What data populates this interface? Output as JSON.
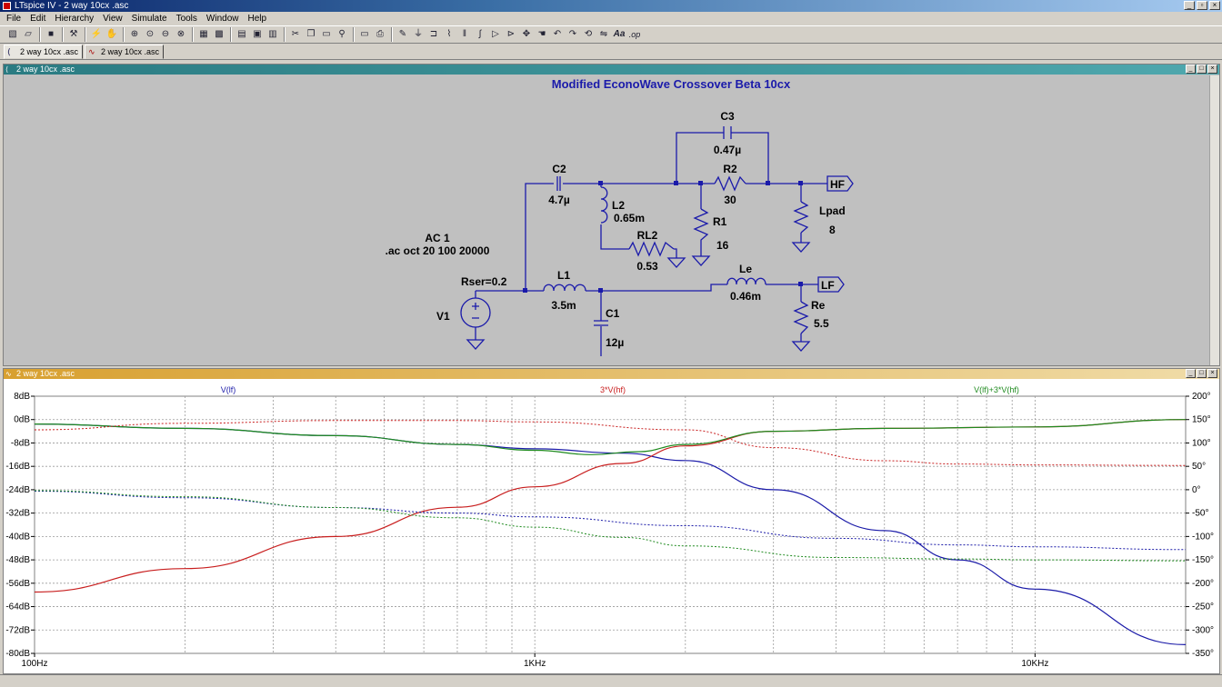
{
  "app": {
    "title": "LTspice IV - 2 way 10cx .asc"
  },
  "menu": [
    "File",
    "Edit",
    "Hierarchy",
    "View",
    "Simulate",
    "Tools",
    "Window",
    "Help"
  ],
  "toolbar_icons": [
    "new-schematic-icon",
    "open-icon",
    "save-icon",
    "control-panel-icon",
    "run-icon",
    "halt-icon",
    "zoom-in-icon",
    "pan-icon",
    "zoom-out-icon",
    "zoom-fit-icon",
    "autoscale-icon",
    "grid-icon",
    "tile-horizontal-icon",
    "cascade-icon",
    "tile-vertical-icon",
    "cut-icon",
    "copy-icon",
    "paste-icon",
    "find-icon",
    "print-setup-icon",
    "print-icon",
    "wire-icon",
    "ground-icon",
    "label-icon",
    "resistor-icon",
    "capacitor-icon",
    "inductor-icon",
    "diode-icon",
    "component-icon",
    "move-icon",
    "drag-icon",
    "undo-icon",
    "redo-icon",
    "rotate-icon",
    "mirror-icon",
    "text-icon",
    "spice-directive-icon"
  ],
  "tabs": [
    {
      "label": "2 way 10cx .asc",
      "icon": "schematic-icon"
    },
    {
      "label": "2 way 10cx .asc",
      "icon": "waveform-icon"
    }
  ],
  "schematic": {
    "window_title": "2 way 10cx .asc",
    "title": "Modified EconoWave Crossover Beta 10cx",
    "source": {
      "name": "V1",
      "value": "AC 1",
      "directive": ".ac oct 20 100 20000",
      "rser": "Rser=0.2"
    },
    "components": [
      {
        "ref": "C3",
        "value": "0.47µ"
      },
      {
        "ref": "R2",
        "value": "30"
      },
      {
        "ref": "C2",
        "value": "4.7µ"
      },
      {
        "ref": "L2",
        "value": "0.65m"
      },
      {
        "ref": "RL2",
        "value": "0.53"
      },
      {
        "ref": "R1",
        "value": "16"
      },
      {
        "ref": "Lpad",
        "value": "8"
      },
      {
        "ref": "L1",
        "value": "3.5m"
      },
      {
        "ref": "C1",
        "value": "12µ"
      },
      {
        "ref": "Le",
        "value": "0.46m"
      },
      {
        "ref": "Re",
        "value": "5.5"
      }
    ],
    "net_labels": [
      "HF",
      "LF"
    ]
  },
  "plot": {
    "window_title": "2 way 10cx .asc",
    "colors": {
      "v_lf": "#1a1aa8",
      "v_hf3": "#c81e1e",
      "v_sum": "#1e8a1e"
    }
  },
  "chart_data": {
    "type": "line",
    "x_scale": "log",
    "xlim": [
      100,
      20000
    ],
    "x_ticks": [
      "100Hz",
      "1KHz",
      "10KHz"
    ],
    "y_left": {
      "label": "",
      "ylim": [
        -80,
        8
      ],
      "ticks": [
        "8dB",
        "0dB",
        "-8dB",
        "-16dB",
        "-24dB",
        "-32dB",
        "-40dB",
        "-48dB",
        "-56dB",
        "-64dB",
        "-72dB",
        "-80dB"
      ]
    },
    "y_right": {
      "label": "",
      "ylim": [
        -350,
        200
      ],
      "ticks": [
        "200°",
        "150°",
        "100°",
        "50°",
        "0°",
        "-50°",
        "-100°",
        "-150°",
        "-200°",
        "-250°",
        "-300°",
        "-350°"
      ]
    },
    "grid": true,
    "legend": [
      {
        "name": "V(lf)",
        "color": "#1a1aa8"
      },
      {
        "name": "3*V(hf)",
        "color": "#c81e1e"
      },
      {
        "name": "V(lf)+3*V(hf)",
        "color": "#1e8a1e"
      }
    ],
    "series": [
      {
        "name": "V(lf)",
        "axis": "magnitude",
        "x": [
          100,
          200,
          400,
          700,
          1000,
          1500,
          2000,
          3000,
          5000,
          7000,
          10000,
          20000
        ],
        "y": [
          -1.5,
          -3,
          -5.5,
          -8.5,
          -10,
          -11.5,
          -14,
          -24,
          -38,
          -48,
          -58,
          -77
        ]
      },
      {
        "name": "3*V(hf)",
        "axis": "magnitude",
        "x": [
          100,
          200,
          400,
          700,
          1000,
          1500,
          2000,
          3000,
          5000,
          10000,
          20000
        ],
        "y": [
          -59,
          -51,
          -40,
          -30,
          -23,
          -15,
          -9,
          -4,
          -3,
          -2.5,
          0
        ]
      },
      {
        "name": "V(lf)+3*V(hf)",
        "axis": "magnitude",
        "x": [
          100,
          200,
          400,
          700,
          1000,
          1300,
          1600,
          2000,
          3000,
          5000,
          10000,
          20000
        ],
        "y": [
          -1.5,
          -3,
          -5.5,
          -8.5,
          -10.5,
          -12,
          -11,
          -8.5,
          -4,
          -3,
          -2.5,
          0
        ]
      },
      {
        "name": "V(lf)",
        "axis": "phase",
        "x": [
          100,
          200,
          400,
          700,
          1000,
          2000,
          4000,
          7000,
          10000,
          20000
        ],
        "y": [
          -3,
          -17,
          -38,
          -50,
          -58,
          -77,
          -104,
          -118,
          -122,
          -128
        ]
      },
      {
        "name": "3*V(hf)",
        "axis": "phase",
        "x": [
          100,
          200,
          400,
          700,
          1000,
          2000,
          3000,
          5000,
          7000,
          10000,
          20000
        ],
        "y": [
          128,
          142,
          148,
          148,
          145,
          128,
          90,
          62,
          55,
          53,
          52
        ]
      },
      {
        "name": "V(lf)+3*V(hf)",
        "axis": "phase",
        "x": [
          100,
          200,
          400,
          700,
          1000,
          1500,
          2000,
          4000,
          7000,
          10000,
          20000
        ],
        "y": [
          -2,
          -15,
          -38,
          -60,
          -80,
          -102,
          -120,
          -145,
          -148,
          -150,
          -152
        ]
      }
    ]
  }
}
